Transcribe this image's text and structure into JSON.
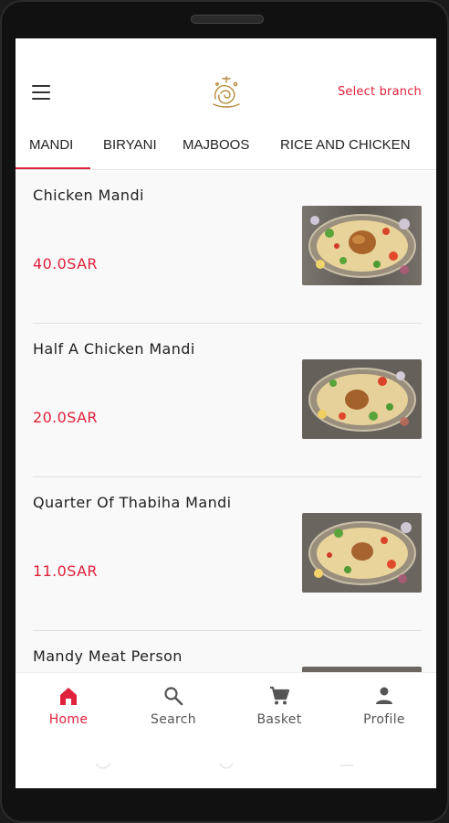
{
  "header": {
    "branch_label": "Select branch"
  },
  "tabs": [
    {
      "label": "MANDI",
      "active": true
    },
    {
      "label": "BIRYANI",
      "active": false
    },
    {
      "label": "MAJBOOS",
      "active": false
    },
    {
      "label": "RICE AND CHICKEN",
      "active": false
    }
  ],
  "menu_items": [
    {
      "name": "Chicken Mandi",
      "price": "40.0SAR"
    },
    {
      "name": "Half A Chicken Mandi",
      "price": "20.0SAR"
    },
    {
      "name": "Quarter Of Thabiha Mandi",
      "price": "11.0SAR"
    },
    {
      "name": "Mandy Meat Person",
      "price": ""
    }
  ],
  "bottom_nav": {
    "home": "Home",
    "search": "Search",
    "basket": "Basket",
    "profile": "Profile"
  },
  "colors": {
    "accent": "#e0213c",
    "text": "#1f1f1f",
    "muted": "#555555"
  },
  "icons": [
    "menu-icon",
    "logo",
    "home-icon",
    "search-icon",
    "cart-icon",
    "person-icon"
  ]
}
